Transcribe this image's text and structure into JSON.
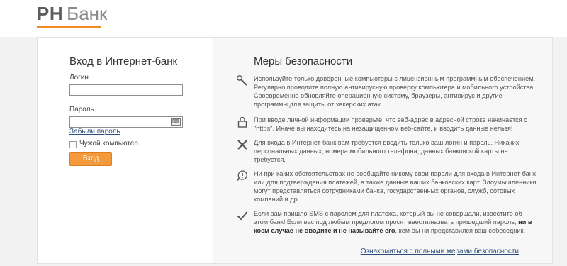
{
  "logo": {
    "brand": "РН",
    "product": "Банк"
  },
  "login": {
    "title": "Вход в Интернет-банк",
    "login_label": "Логин",
    "password_label": "Пароль",
    "keyboard_icon": "keyboard-icon",
    "forgot_password": "Забыли пароль",
    "foreign_computer": "Чужой компьютер",
    "submit": "Вход"
  },
  "security": {
    "title": "Меры безопасности",
    "items": [
      {
        "icon": "wrench-icon",
        "text": "Используйте только доверенные компьютеры с лицензионным программным обеспечением. Регулярно проводите полную антивирусную проверку компьютера и мобильного устройства. Своевременно обновляйте операционную систему, браузеры, антивирус и другие программы для защиты от хакерских атак."
      },
      {
        "icon": "lock-icon",
        "text": "При вводе личной информации проверьте, что веб-адрес в адресной строке начинается с \"https\". Иначе вы находитесь на незащищенном веб-сайте, и вводить данные нельзя!"
      },
      {
        "icon": "cross-icon",
        "text": "Для входа в Интернет-банк вам требуется вводить только ваш логин и пароль. Никаких персональных данных, номера мобильного телефона, данных банковской карты не требуется."
      },
      {
        "icon": "warning-bubble-icon",
        "text": "Ни при каких обстоятельствах не сообщайте никому свои пароли для входа в Интернет-банк или для подтверждения платежей, а также данные ваших банковских карт. Злоумышленники могут представляться сотрудниками банка, государственных органов, служб, сотовых компаний и др."
      },
      {
        "icon": "checkmark-icon",
        "text_before": "Если вам пришло SMS с паролем для платежа, который вы не совершали, известите об этом банк! Если вас под любым предлогом просят ввести/назвать пришедший пароль, ",
        "text_bold": "ни в коем случае не вводите и не называйте его",
        "text_after": ", кем бы ни представился ваш собеседник."
      }
    ],
    "full_link": "Ознакомиться с полными мерами безопасности"
  }
}
